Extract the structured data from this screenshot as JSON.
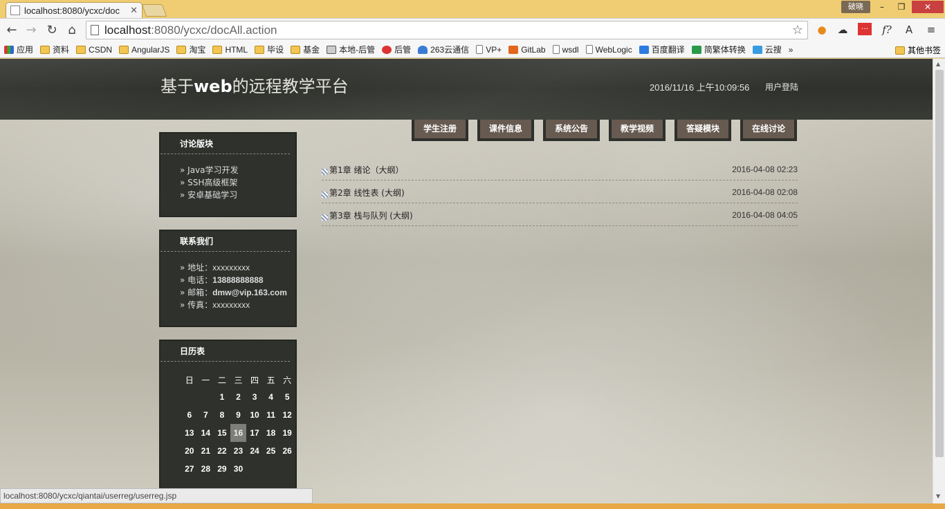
{
  "browser": {
    "tab_title": "localhost:8080/ycxc/doc",
    "user_badge": "破晓",
    "url_host": "localhost",
    "url_rest": ":8080/ycxc/docAll.action",
    "status_url": "localhost:8080/ycxc/qiantai/userreg/userreg.jsp",
    "bookmarks": [
      "应用",
      "资料",
      "CSDN",
      "AngularJS",
      "淘宝",
      "HTML",
      "毕设",
      "基金",
      "本地-后管",
      "后管",
      "263云通信",
      "VP+",
      "GitLab",
      "wsdl",
      "WebLogic",
      "百度翻译",
      "简繁体转换",
      "云搜"
    ],
    "bookmarks_more": "»",
    "other_bookmarks": "其他书签"
  },
  "header": {
    "title_pre": "基于",
    "title_bold": "web",
    "title_post": "的远程教学平台",
    "datetime": "2016/11/16 上午10:09:56",
    "login": "用户登陆"
  },
  "menu": [
    "学生注册",
    "课件信息",
    "系统公告",
    "教学视频",
    "答疑模块",
    "在线讨论"
  ],
  "forum_box": {
    "title": "讨论版块",
    "items": [
      "» Java学习开发",
      "» SSH高级框架",
      "» 安卓基础学习"
    ]
  },
  "contact_box": {
    "title": "联系我们",
    "address_label": "» 地址：",
    "address": "xxxxxxxxx",
    "phone_label": "» 电话：",
    "phone": "13888888888",
    "email_label": "» 邮箱：",
    "email": "dmw@vip.163.com",
    "fax_label": "» 传真：",
    "fax": "xxxxxxxxx"
  },
  "calendar": {
    "title": "日历表",
    "weekdays": [
      "日",
      "一",
      "二",
      "三",
      "四",
      "五",
      "六"
    ],
    "weeks": [
      [
        "",
        "",
        "1",
        "2",
        "3",
        "4",
        "5"
      ],
      [
        "6",
        "7",
        "8",
        "9",
        "10",
        "11",
        "12"
      ],
      [
        "13",
        "14",
        "15",
        "16",
        "17",
        "18",
        "19"
      ],
      [
        "20",
        "21",
        "22",
        "23",
        "24",
        "25",
        "26"
      ],
      [
        "27",
        "28",
        "29",
        "30",
        "",
        "",
        ""
      ]
    ],
    "today": "16"
  },
  "documents": [
    {
      "title": "第1章 绪论（大纲）",
      "date": "2016-04-08 02:23"
    },
    {
      "title": "第2章 线性表 (大纲)",
      "date": "2016-04-08 02:08"
    },
    {
      "title": "第3章 栈与队列 (大纲)",
      "date": "2016-04-08 04:05"
    }
  ],
  "colors": {
    "header_bg": "#2f312d",
    "menu_bg": "#675a50",
    "page_bg": "#c2bfb0"
  }
}
